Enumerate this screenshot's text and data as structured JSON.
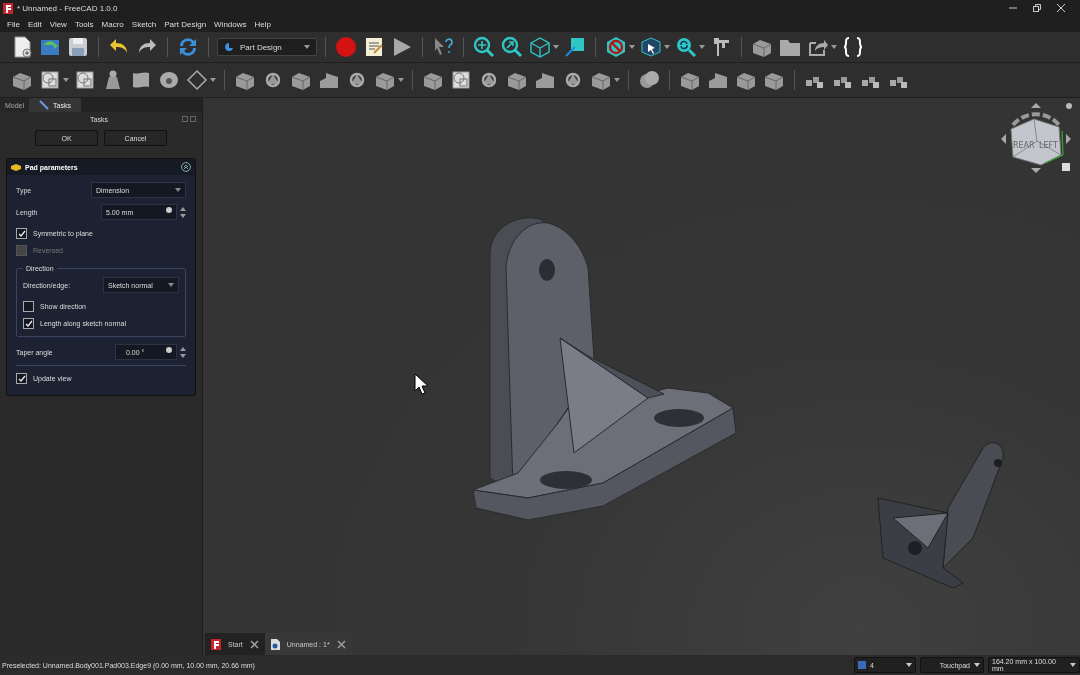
{
  "window": {
    "title": "* Unnamed - FreeCAD 1.0.0"
  },
  "menu": [
    "File",
    "Edit",
    "View",
    "Tools",
    "Macro",
    "Sketch",
    "Part Design",
    "Windows",
    "Help"
  ],
  "toolbar": {
    "workbench": "Part Design"
  },
  "panel_tabs": [
    {
      "label": "Model",
      "selected": false
    },
    {
      "label": "Tasks",
      "selected": true
    }
  ],
  "task_header": "Tasks",
  "buttons": [
    "OK",
    "Cancel"
  ],
  "pad": {
    "title": "Pad parameters",
    "type_label": "Type",
    "type_value": "Dimension",
    "length_label": "Length",
    "length_value": "5.00 mm",
    "options": [
      {
        "label": "Symmetric to plane",
        "checked": true,
        "disabled": false
      },
      {
        "label": "Reversed",
        "checked": false,
        "disabled": true
      }
    ],
    "direction": {
      "title": "Direction",
      "edge_label": "Direction/edge:",
      "edge_value": "Sketch normal",
      "options": [
        {
          "label": "Show direction",
          "checked": false
        },
        {
          "label": "Length along sketch normal",
          "checked": true
        }
      ]
    },
    "taper_label": "Taper angle",
    "taper_value": "0.00 °",
    "update": {
      "label": "Update view",
      "checked": true
    }
  },
  "navcube": {
    "faces": [
      "REAR",
      "LEFT"
    ]
  },
  "doc_tabs": [
    {
      "label": "Start",
      "selected": false
    },
    {
      "label": "Unnamed : 1*",
      "selected": true
    }
  ],
  "status_bar": {
    "message": "Preselected: Unnamed.Body001.Pad003.Edge9 (0.00 mm, 10.00 mm, 20.66 mm)",
    "chips": [
      "4",
      "Touchpad",
      "164.20 mm x 100.00 mm"
    ]
  }
}
